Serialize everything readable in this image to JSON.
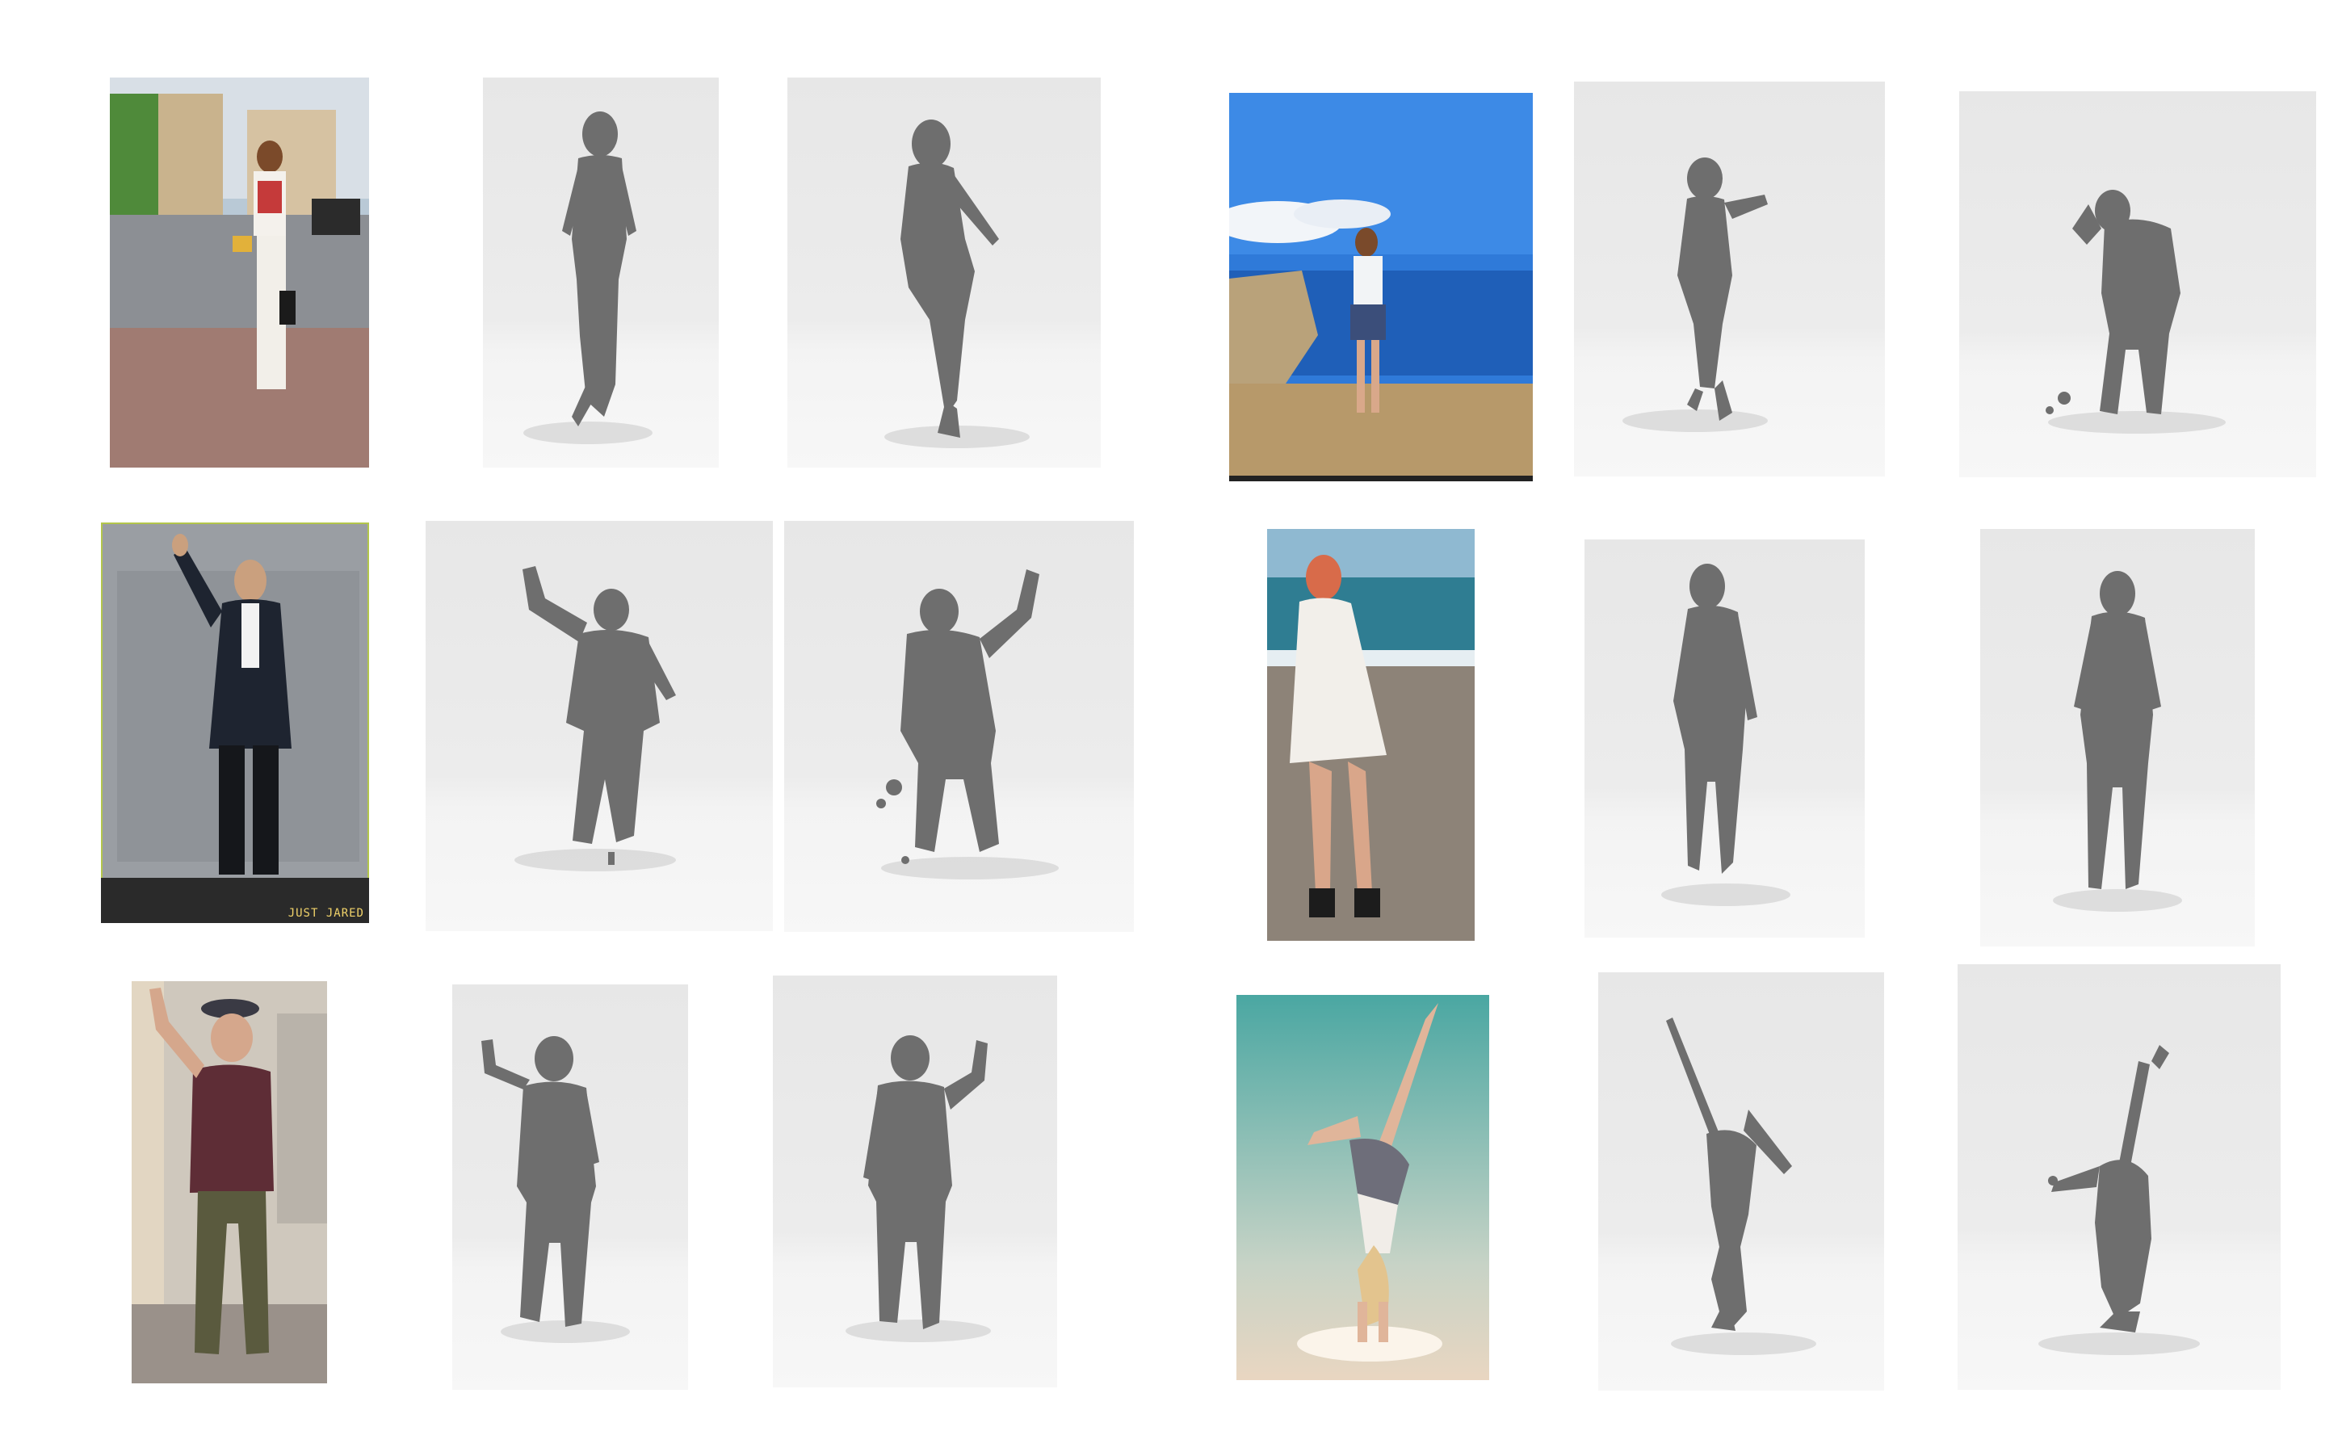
{
  "figure": {
    "rows": [
      {
        "examples": [
          {
            "input": "woman-street-photo",
            "views": [
              "front-view",
              "side-view"
            ]
          },
          {
            "input": "woman-cliff-sea-photo",
            "views": [
              "front-view",
              "back-view"
            ]
          }
        ]
      },
      {
        "examples": [
          {
            "input": "man-suit-waving-photo",
            "views": [
              "front-view",
              "back-view"
            ],
            "watermark": "JUST JARED"
          },
          {
            "input": "woman-red-hair-beach-photo",
            "views": [
              "front-view",
              "back-view"
            ]
          }
        ]
      },
      {
        "examples": [
          {
            "input": "man-peace-sign-photo",
            "views": [
              "front-view",
              "back-view"
            ]
          },
          {
            "input": "woman-handstand-illustration",
            "views": [
              "front-view",
              "back-view"
            ]
          }
        ]
      }
    ],
    "colors": {
      "background": "#ffffff",
      "render_background": "#e9e9e9",
      "mesh": "#6e6e6e"
    }
  }
}
